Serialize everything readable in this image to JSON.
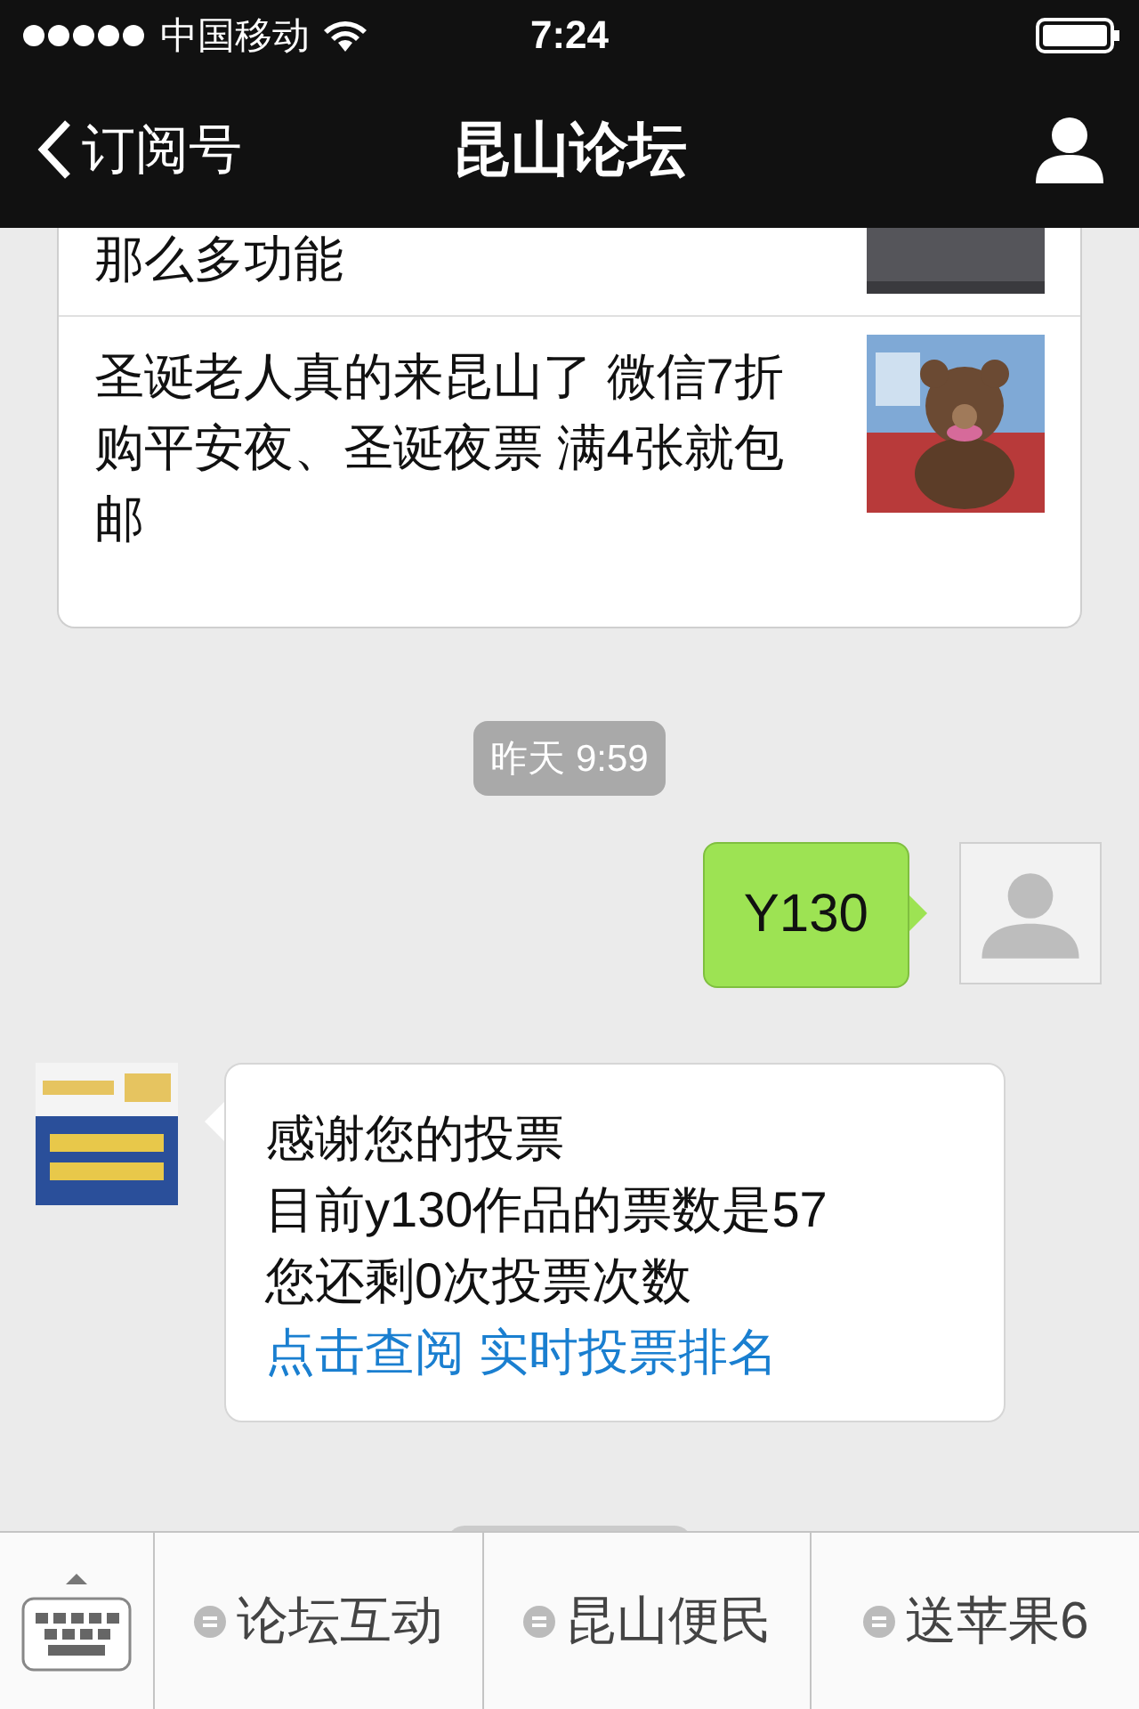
{
  "status_bar": {
    "carrier": "中国移动",
    "time": "7:24"
  },
  "nav": {
    "back": "订阅号",
    "title": "昆山论坛"
  },
  "articles": [
    {
      "title": "那么多功能"
    },
    {
      "title": "圣诞老人真的来昆山了 微信7折购平安夜、圣诞夜票  满4张就包邮"
    }
  ],
  "messages": [
    {
      "kind": "time",
      "text": "昨天 9:59"
    },
    {
      "kind": "outgoing",
      "text": "Y130"
    },
    {
      "kind": "incoming",
      "lines": [
        "感谢您的投票",
        "目前y130作品的票数是57",
        "您还剩0次投票次数"
      ],
      "link": "点击查阅 实时投票排名"
    }
  ],
  "menu": {
    "items": [
      "论坛互动",
      "昆山便民",
      "送苹果6"
    ]
  }
}
